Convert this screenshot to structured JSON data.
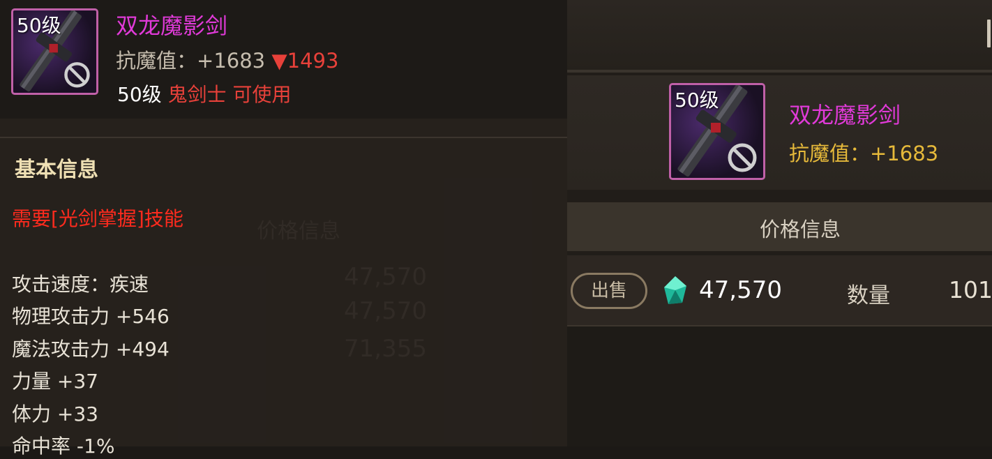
{
  "tooltip": {
    "item_level_badge": "50级",
    "item_name": "双龙魔影剑",
    "resist_label": "抗魔值：",
    "resist_value": "+1683",
    "resist_drop_arrow": "▼",
    "resist_drop_value": "1493",
    "req_level": "50级",
    "req_class": "鬼剑士",
    "req_usable": "可使用",
    "section_title": "基本信息",
    "skill_requirement": "需要[光剑掌握]技能",
    "attributes": [
      "攻击速度：疾速",
      "物理攻击力 +546",
      "魔法攻击力 +494",
      "力量 +37",
      "体力 +33",
      "命中率 -1%"
    ]
  },
  "item_panel": {
    "item_level_badge": "50级",
    "item_name": "双龙魔影剑",
    "resist_text": "抗魔值：+1683"
  },
  "price_section": {
    "header": "价格信息",
    "sell_button": "出售",
    "price": "47,570",
    "quantity_label": "数量",
    "quantity_value": "101"
  },
  "background_ghost": {
    "header": "价格信息",
    "prices": [
      "47,570",
      "47,570",
      "71,355"
    ]
  },
  "icons": {
    "item": "sword-icon",
    "restriction": "prohibited-icon",
    "currency": "gem-icon"
  },
  "colors": {
    "item_name": "#e03ad8",
    "resist_value_gold": "#e6b93a",
    "warning_red": "#ff2b1e",
    "section_title": "#efe0b4"
  }
}
